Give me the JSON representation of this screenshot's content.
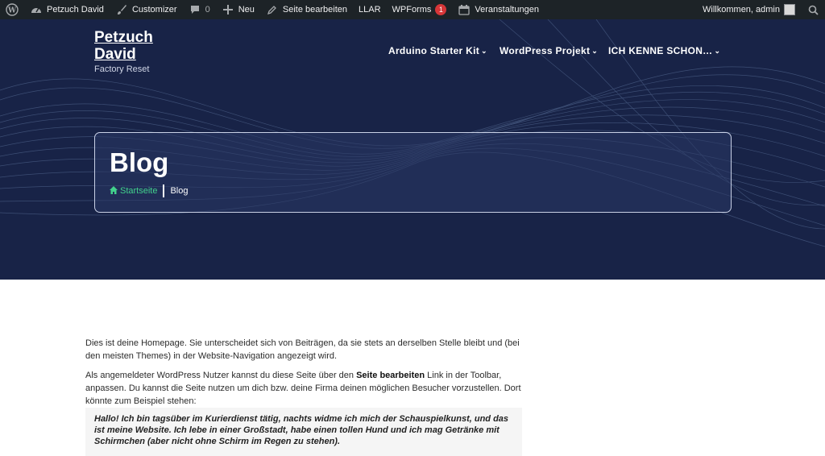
{
  "adminbar": {
    "site_name": "Petzuch David",
    "customizer": "Customizer",
    "comments_count": "0",
    "new": "Neu",
    "edit_page": "Seite bearbeiten",
    "llar": "LLAR",
    "wpforms": "WPForms",
    "wpforms_badge": "1",
    "events": "Veranstaltungen",
    "welcome": "Willkommen, admin"
  },
  "site": {
    "title_line1": "Petzuch",
    "title_line2": "David",
    "tagline": "Factory Reset"
  },
  "nav": {
    "items": [
      "Arduino Starter Kit",
      "WordPress Projekt",
      "ICH KENNE SCHON…"
    ]
  },
  "page": {
    "title": "Blog",
    "breadcrumb_home": "Startseite",
    "breadcrumb_current": "Blog"
  },
  "content": {
    "p1": "Dies ist deine Homepage. Sie unterscheidet sich von Beiträgen, da sie stets an derselben Stelle bleibt und (bei den meisten Themes) in der Website-Navigation angezeigt wird.",
    "p2_before": "Als angemeldeter WordPress Nutzer kannst du diese Seite über den ",
    "p2_bold": "Seite bearbeiten",
    "p2_after": " Link in der Toolbar, anpassen. Du kannst die Seite nutzen um dich bzw. deine Firma deinen möglichen Besucher vorzustellen. Dort könnte zum Beispiel stehen:",
    "quote": "Hallo! Ich bin tagsüber im Kurierdienst tätig, nachts widme ich mich der Schauspielkunst, und das ist meine Website. Ich lebe in einer Großstadt, habe einen tollen Hund und ich mag Getränke mit Schirmchen (aber nicht ohne Schirm im Regen zu stehen)."
  },
  "colors": {
    "adminbar_bg": "#1d2327",
    "hero_bg": "#182347",
    "accent_green": "#42d18c",
    "badge_red": "#d63638"
  }
}
